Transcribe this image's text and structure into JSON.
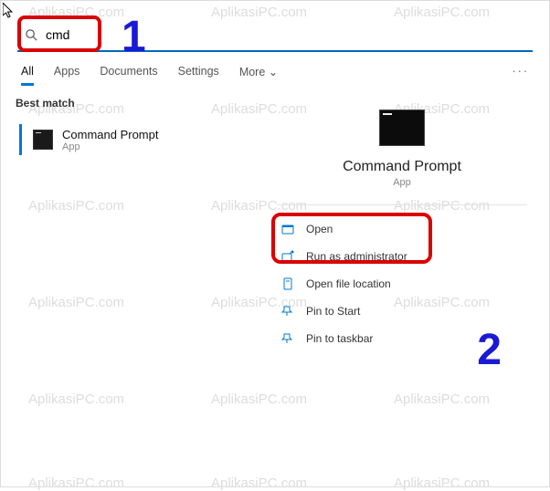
{
  "search": {
    "value": "cmd"
  },
  "tabs": {
    "all": "All",
    "apps": "Apps",
    "documents": "Documents",
    "settings": "Settings",
    "more": "More"
  },
  "left": {
    "section": "Best match",
    "result": {
      "title": "Command Prompt",
      "sub": "App"
    }
  },
  "right": {
    "title": "Command Prompt",
    "sub": "App",
    "actions": {
      "open": "Open",
      "runadmin": "Run as administrator",
      "openloc": "Open file location",
      "pinstart": "Pin to Start",
      "pintask": "Pin to taskbar"
    }
  },
  "annotations": {
    "n1": "1",
    "n2": "2"
  },
  "watermark": "AplikasiPC.com"
}
